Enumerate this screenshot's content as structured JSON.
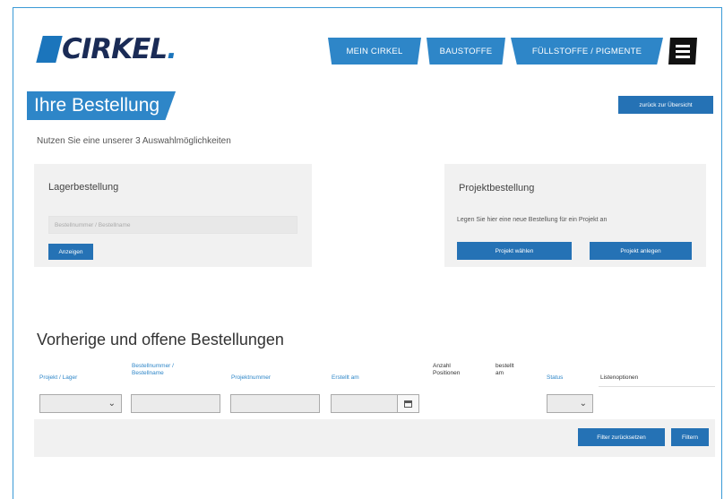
{
  "brand": {
    "name": "CIRKEL",
    "dot": "."
  },
  "nav": {
    "items": [
      "MEIN CIRKEL",
      "BAUSTOFFE",
      "FÜLLSTOFFE / PIGMENTE"
    ],
    "menu_icon": "hamburger-menu-icon"
  },
  "page": {
    "title": "Ihre Bestellung",
    "back_label": "zurück zur Übersicht",
    "intro": "Nutzen Sie eine unserer 3 Auswahlmöglichkeiten"
  },
  "lager": {
    "title": "Lagerbestellung",
    "input_placeholder": "Bestellnummer / Bestellname",
    "button": "Anzeigen"
  },
  "projekt": {
    "title": "Projektbestellung",
    "text": "Legen Sie hier eine neue Bestellung für ein Projekt an",
    "btn_select": "Projekt wählen",
    "btn_create": "Projekt anlegen"
  },
  "orders": {
    "title": "Vorherige und offene Bestellungen",
    "columns": {
      "c1": "Projekt / Lager",
      "c2a": "Bestellnummer /",
      "c2b": "Bestellname",
      "c3": "Projektnummer",
      "c4": "Erstellt am",
      "c5a": "Anzahl",
      "c5b": "Positionen",
      "c6a": "bestellt",
      "c6b": "am",
      "c7": "Status",
      "c8": "Listenoptionen"
    },
    "chevron": "⌄",
    "btn_reset": "Filter zurücksetzen",
    "btn_filter": "Filtern"
  },
  "colors": {
    "accent": "#2e86c8",
    "button": "#2572b5",
    "brand_dark": "#1a2b56",
    "panel": "#f1f1f1"
  }
}
